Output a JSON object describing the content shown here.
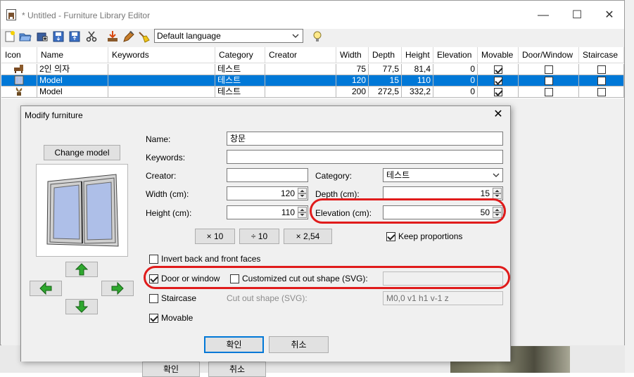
{
  "window": {
    "title": "* Untitled - Furniture Library Editor",
    "minimize": "—",
    "maximize": "☐",
    "close": "✕"
  },
  "toolbar": {
    "icons": [
      "new-icon",
      "open-icon",
      "add-icon",
      "save-icon",
      "save-as-icon",
      "cut-icon",
      "import-icon",
      "edit-icon",
      "clean-icon",
      "help-icon"
    ],
    "language": "Default language"
  },
  "table": {
    "columns": [
      "Icon",
      "Name",
      "Keywords",
      "Category",
      "Creator",
      "Width",
      "Depth",
      "Height",
      "Elevation",
      "Movable",
      "Door/Window",
      "Staircase"
    ],
    "rows": [
      {
        "icon": "chair-icon",
        "name": "2인 의자",
        "keywords": "",
        "category": "테스트",
        "creator": "",
        "width": "75",
        "depth": "77,5",
        "height": "81,4",
        "elevation": "0",
        "movable": true,
        "door_window": false,
        "staircase": false,
        "selected": false
      },
      {
        "icon": "window-icon",
        "name": "Model",
        "keywords": "",
        "category": "테스트",
        "creator": "",
        "width": "120",
        "depth": "15",
        "height": "110",
        "elevation": "0",
        "movable": true,
        "door_window": false,
        "staircase": false,
        "selected": true
      },
      {
        "icon": "plant-icon",
        "name": "Model",
        "keywords": "",
        "category": "테스트",
        "creator": "",
        "width": "200",
        "depth": "272,5",
        "height": "332,2",
        "elevation": "0",
        "movable": true,
        "door_window": false,
        "staircase": false,
        "selected": false
      }
    ]
  },
  "dialog": {
    "title": "Modify furniture",
    "close": "✕",
    "change_model": "Change model",
    "name_label": "Name:",
    "name_value": "창문",
    "keywords_label": "Keywords:",
    "keywords_value": "",
    "creator_label": "Creator:",
    "creator_value": "",
    "category_label": "Category:",
    "category_value": "테스트",
    "width_label": "Width (cm):",
    "width_value": "120",
    "depth_label": "Depth (cm):",
    "depth_value": "15",
    "height_label": "Height (cm):",
    "height_value": "110",
    "elevation_label": "Elevation (cm):",
    "elevation_value": "50",
    "scale_x10": "× 10",
    "scale_div10": "÷ 10",
    "scale_x254": "× 2,54",
    "keep_proportions": "Keep proportions",
    "keep_proportions_checked": true,
    "invert_faces": "Invert back and front faces",
    "invert_faces_checked": false,
    "door_or_window": "Door or window",
    "door_or_window_checked": true,
    "custom_cutout": "Customized cut out shape (SVG):",
    "custom_cutout_checked": false,
    "custom_cutout_value": "",
    "staircase": "Staircase",
    "staircase_checked": false,
    "cutout_shape_label": "Cut out shape (SVG):",
    "cutout_shape_value": "M0,0 v1 h1 v-1 z",
    "movable": "Movable",
    "movable_checked": true,
    "ok": "확인",
    "cancel": "취소"
  },
  "background_buttons": {
    "ok": "확인",
    "cancel": "취소"
  },
  "colors": {
    "selection": "#0078d7",
    "highlight": "#e01b1b"
  }
}
